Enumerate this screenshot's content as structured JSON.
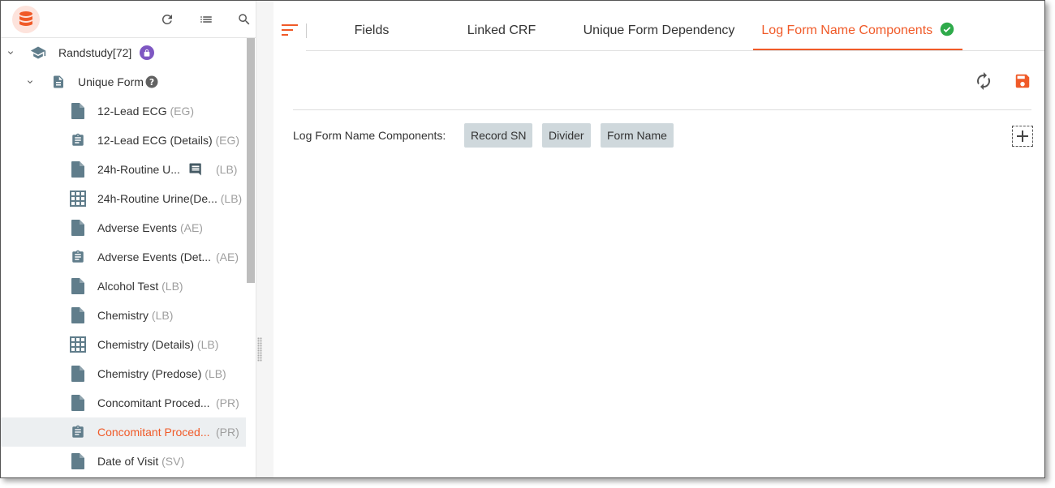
{
  "sidebar": {
    "toolbar": {
      "refresh_icon": "refresh-icon",
      "list_icon": "list-icon",
      "search_icon": "search-icon"
    },
    "study": {
      "label": "Randstudy[72]",
      "icon": "school-icon",
      "badge_icon": "lock-icon",
      "badge_color": "#7e57c2"
    },
    "group": {
      "label": "Unique Form",
      "icon": "document-icon",
      "help_icon": "help-icon"
    },
    "items": [
      {
        "label": "12-Lead ECG",
        "code": "(EG)",
        "icon": "file"
      },
      {
        "label": "12-Lead ECG (Details)",
        "code": "(EG)",
        "icon": "clipboard"
      },
      {
        "label": "24h-Routine U...",
        "code": "(LB)",
        "icon": "file",
        "comment": true
      },
      {
        "label": "24h-Routine Urine(De...",
        "code": "(LB)",
        "icon": "grid"
      },
      {
        "label": "Adverse Events",
        "code": "(AE)",
        "icon": "file"
      },
      {
        "label": "Adverse Events (Det...",
        "code": "(AE)",
        "icon": "clipboard",
        "codeRight": true
      },
      {
        "label": "Alcohol Test",
        "code": "(LB)",
        "icon": "file"
      },
      {
        "label": "Chemistry",
        "code": "(LB)",
        "icon": "file"
      },
      {
        "label": "Chemistry (Details)",
        "code": "(LB)",
        "icon": "grid"
      },
      {
        "label": "Chemistry (Predose)",
        "code": "(LB)",
        "icon": "file"
      },
      {
        "label": "Concomitant Proced...",
        "code": "(PR)",
        "icon": "file",
        "codeRight": true
      },
      {
        "label": "Concomitant Proced...",
        "code": "(PR)",
        "icon": "clipboard",
        "codeRight": true,
        "selected": true
      },
      {
        "label": "Date of Visit",
        "code": "(SV)",
        "icon": "file"
      }
    ]
  },
  "main": {
    "tabs": [
      {
        "label": "Fields"
      },
      {
        "label": "Linked CRF"
      },
      {
        "label": "Unique Form Dependency"
      },
      {
        "label": "Log Form Name Components",
        "active": true
      }
    ],
    "components_label": "Log Form Name Components:",
    "chips": [
      "Record SN",
      "Divider",
      "Form Name"
    ]
  },
  "colors": {
    "accent": "#f05a28",
    "check": "#2eaa4a",
    "icon_gray": "#607d8b",
    "chip_bg": "#cfd8dc"
  }
}
